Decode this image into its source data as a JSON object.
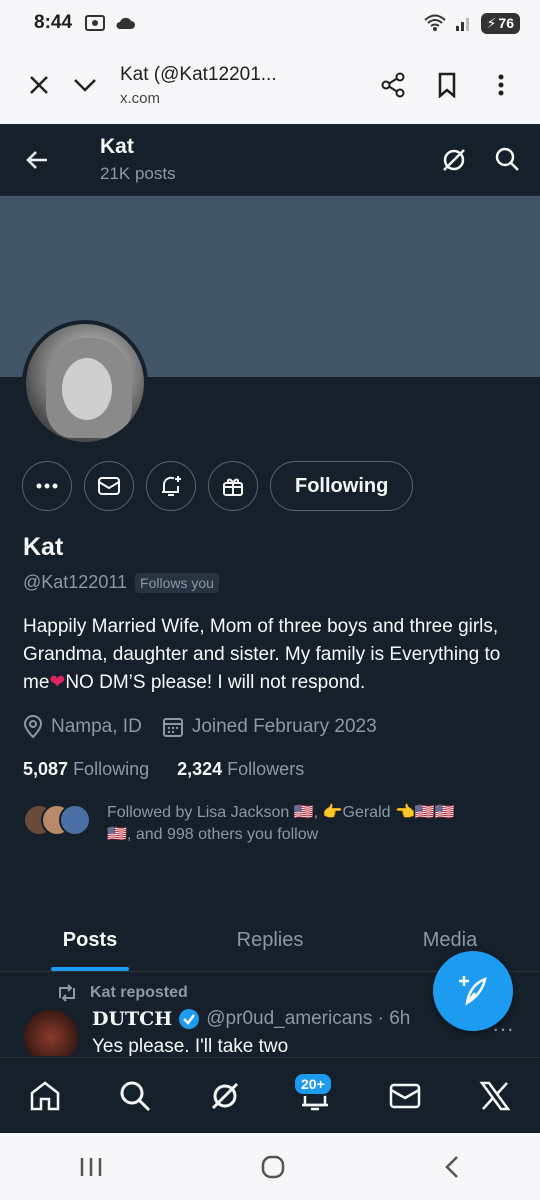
{
  "status_bar": {
    "time": "8:44",
    "battery": "76"
  },
  "browser": {
    "tab_title": "Kat (@Kat12201...",
    "url": "x.com"
  },
  "header": {
    "name": "Kat",
    "post_count": "21K posts"
  },
  "actions": {
    "following_label": "Following"
  },
  "profile": {
    "display_name": "Kat",
    "handle": "@Kat122011",
    "follows_you": "Follows you",
    "bio_part1": "Happily Married Wife, Mom of three boys and three girls, Grandma, daughter and sister. My family is Everything to me",
    "bio_heart": "❤",
    "bio_part2": "NO DM’S please!  I will not respond.",
    "location": "Nampa, ID",
    "joined": "Joined February 2023",
    "following_count": "5,087",
    "following_label": "Following",
    "followers_count": "2,324",
    "followers_label": "Followers",
    "followed_by_line1": "Followed by Lisa Jackson 🇺🇸, 👉Gerald 👈🇺🇸🇺🇸",
    "followed_by_line2": "🇺🇸, and 998 others you follow"
  },
  "tabs": [
    {
      "label": "Posts",
      "active": true
    },
    {
      "label": "Replies",
      "active": false
    },
    {
      "label": "Media",
      "active": false
    }
  ],
  "post": {
    "repost_label": "Kat reposted",
    "author_name": "DUTCH",
    "author_handle": "@pr0ud_americans · 6h",
    "text": "Yes please. I'll take two"
  },
  "bottom_nav": {
    "notifications_badge": "20+"
  },
  "colors": {
    "accent": "#1d9bf0",
    "background": "#15202b",
    "banner": "#425667"
  }
}
